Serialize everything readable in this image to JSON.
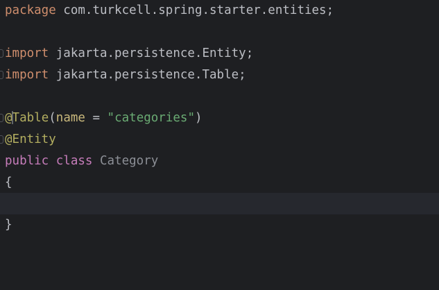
{
  "code": {
    "line1": {
      "keyword": "package",
      "text": " com.turkcell.spring.starter.entities;"
    },
    "line3": {
      "keyword": "import",
      "text": " jakarta.persistence.Entity;"
    },
    "line4": {
      "keyword": "import",
      "text": " jakarta.persistence.Table;"
    },
    "line6": {
      "annotation_at": "@",
      "annotation_name": "Table",
      "open": "(",
      "attr": "name",
      "eq": " = ",
      "value": "\"categories\"",
      "close": ")"
    },
    "line7": {
      "annotation": "@Entity"
    },
    "line8": {
      "modifier": "public",
      "space": " ",
      "keyword": "class",
      "space2": " ",
      "class_name": "Category"
    },
    "line9": {
      "text": "{"
    },
    "line11": {
      "text": "}"
    }
  },
  "colors": {
    "background": "#1e1f22",
    "keyword": "#cf8e6d",
    "annotation": "#b3ae60",
    "string": "#6aab73",
    "class_name": "#8c8f96",
    "text": "#bcbec4"
  }
}
